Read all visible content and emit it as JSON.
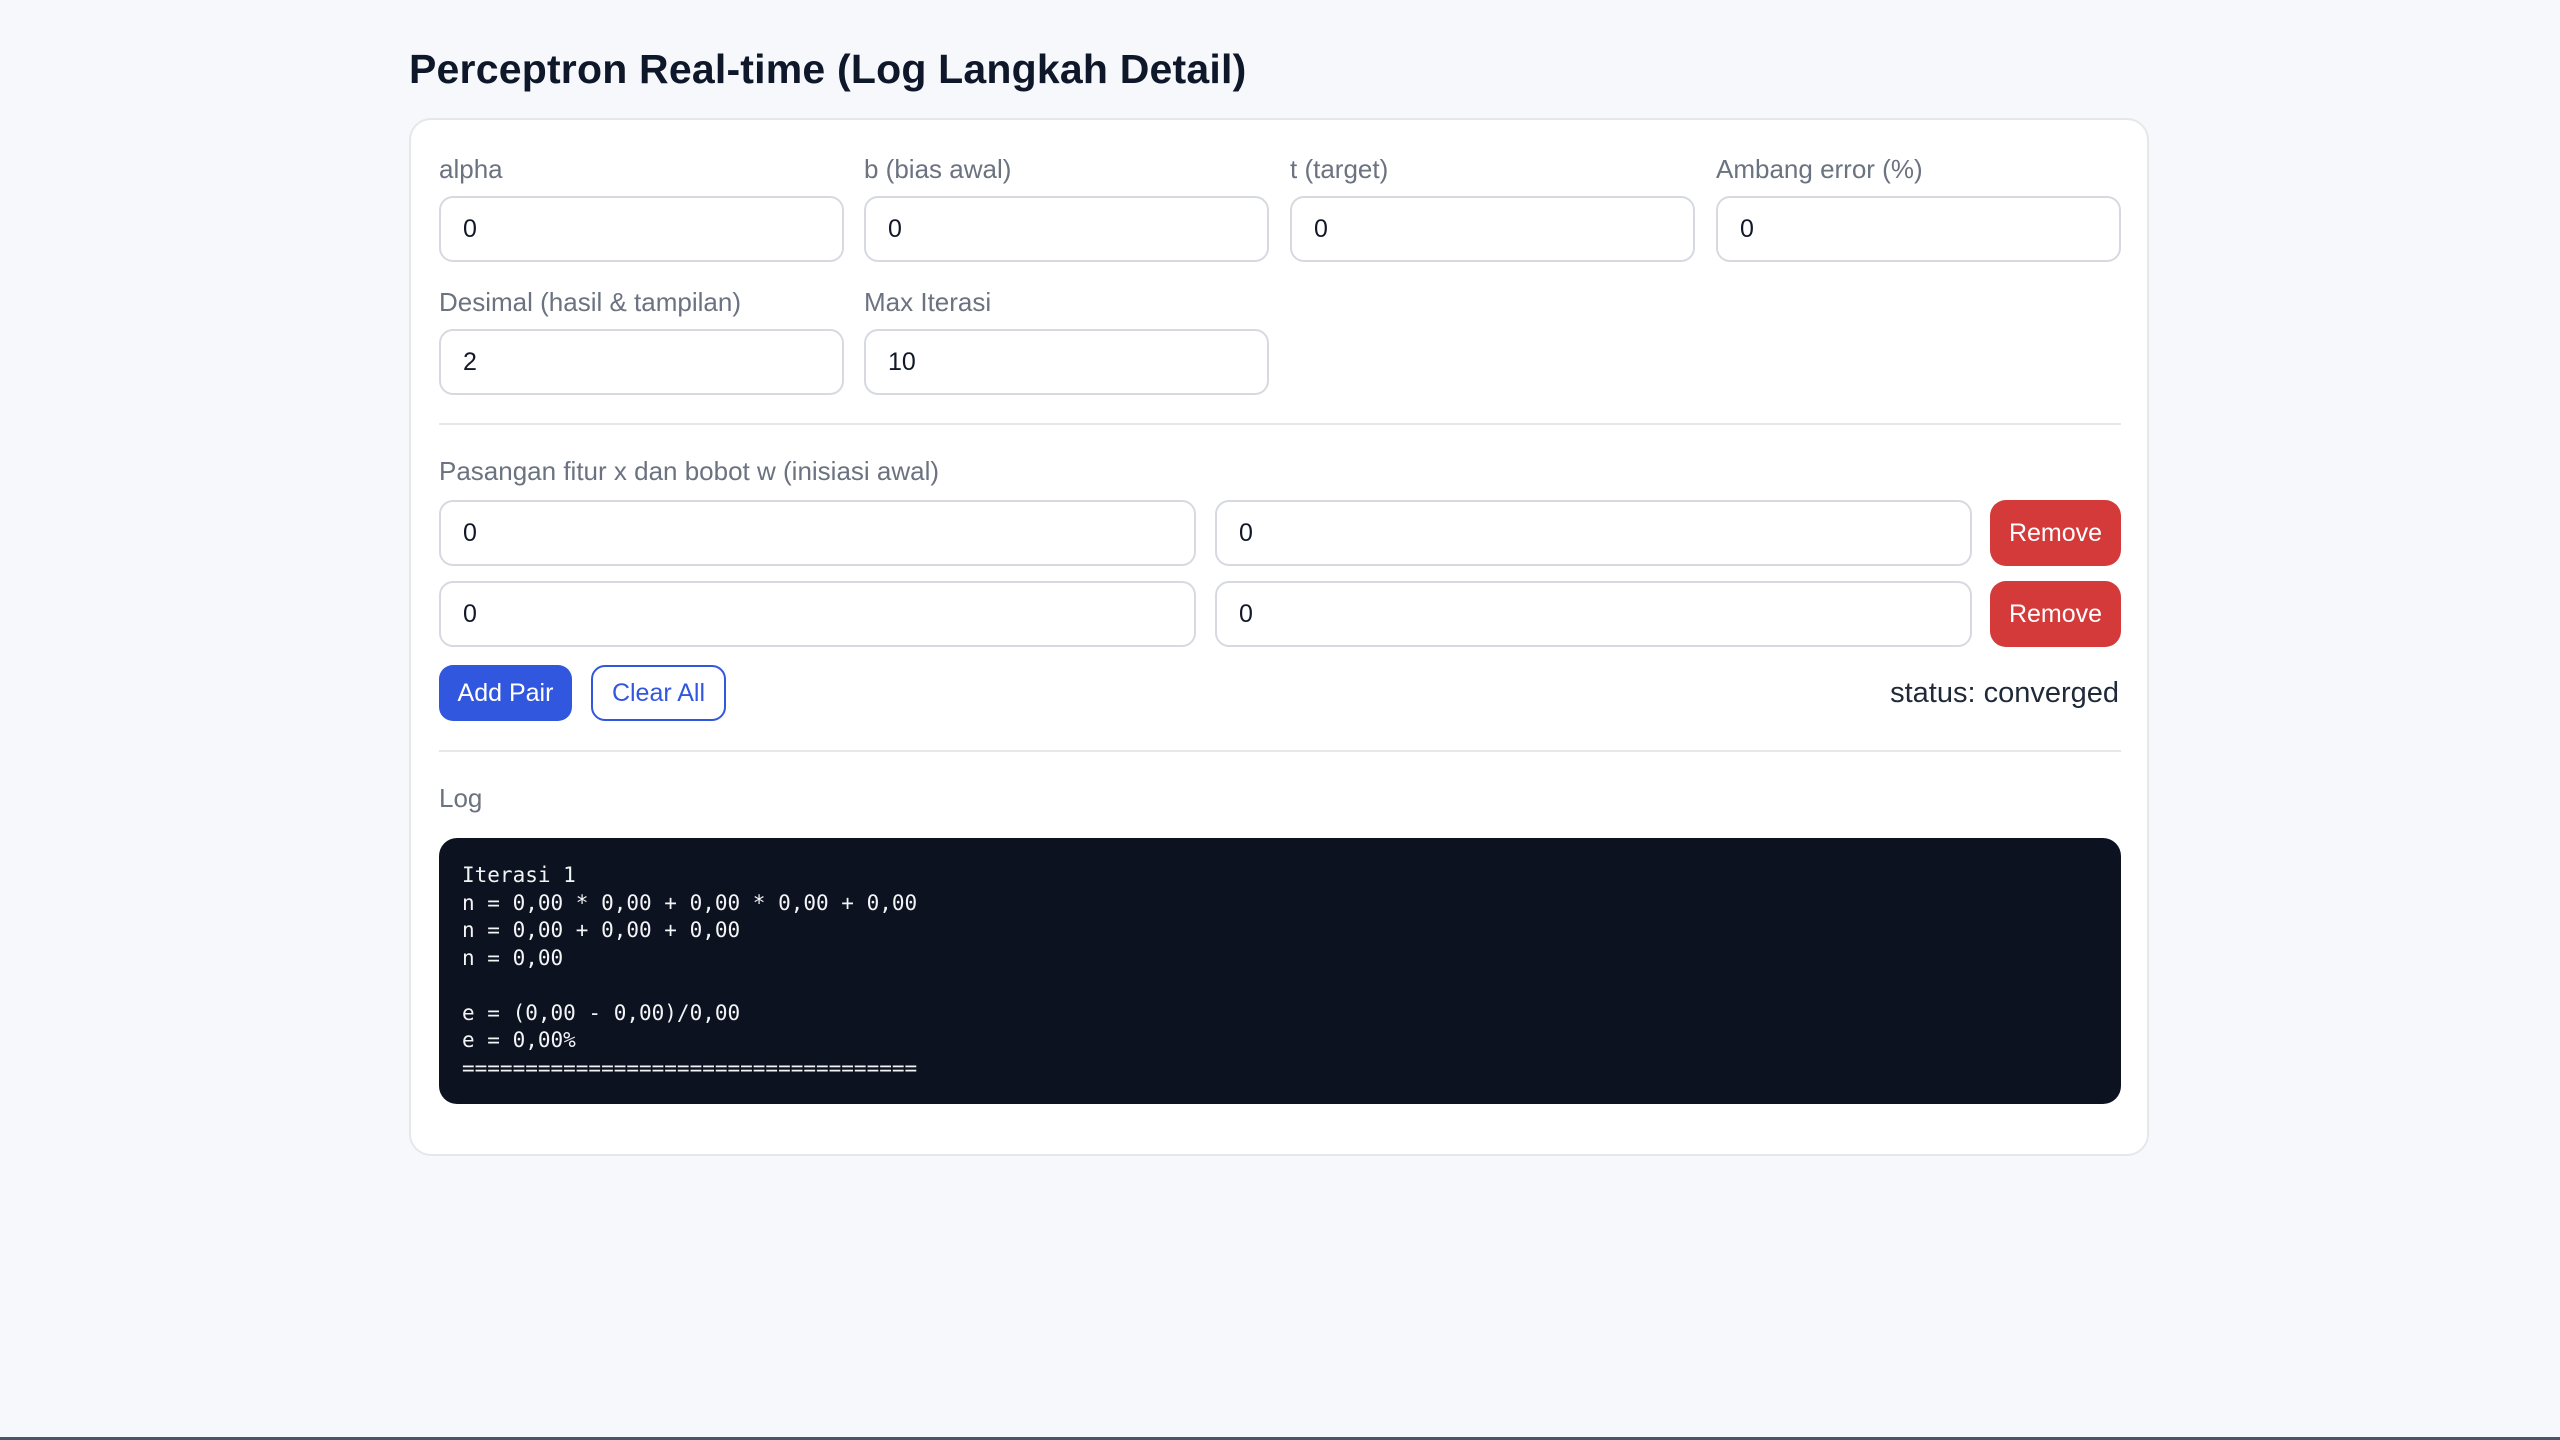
{
  "page": {
    "title": "Perceptron Real-time (Log Langkah Detail)"
  },
  "params": {
    "alpha": {
      "label": "alpha",
      "value": "0"
    },
    "bias": {
      "label": "b (bias awal)",
      "value": "0"
    },
    "target": {
      "label": "t (target)",
      "value": "0"
    },
    "error_threshold": {
      "label": "Ambang error (%)",
      "value": "0"
    },
    "decimals": {
      "label": "Desimal (hasil & tampilan)",
      "value": "2"
    },
    "max_iter": {
      "label": "Max Iterasi",
      "value": "10"
    }
  },
  "pairs": {
    "label": "Pasangan fitur x dan bobot w (inisiasi awal)",
    "rows": [
      {
        "x": "0",
        "w": "0",
        "remove_label": "Remove"
      },
      {
        "x": "0",
        "w": "0",
        "remove_label": "Remove"
      }
    ]
  },
  "actions": {
    "add_label": "Add Pair",
    "clear_label": "Clear All"
  },
  "status": {
    "text": "status: converged"
  },
  "log": {
    "label": "Log",
    "content": "Iterasi 1\nn = 0,00 * 0,00 + 0,00 * 0,00 + 0,00\nn = 0,00 + 0,00 + 0,00\nn = 0,00\n\ne = (0,00 - 0,00)/0,00\ne = 0,00%\n===================================="
  },
  "colors": {
    "primary": "#3257df",
    "danger": "#d43a3a",
    "log_background": "#0d1220",
    "page_background": "#f6f8fb"
  }
}
